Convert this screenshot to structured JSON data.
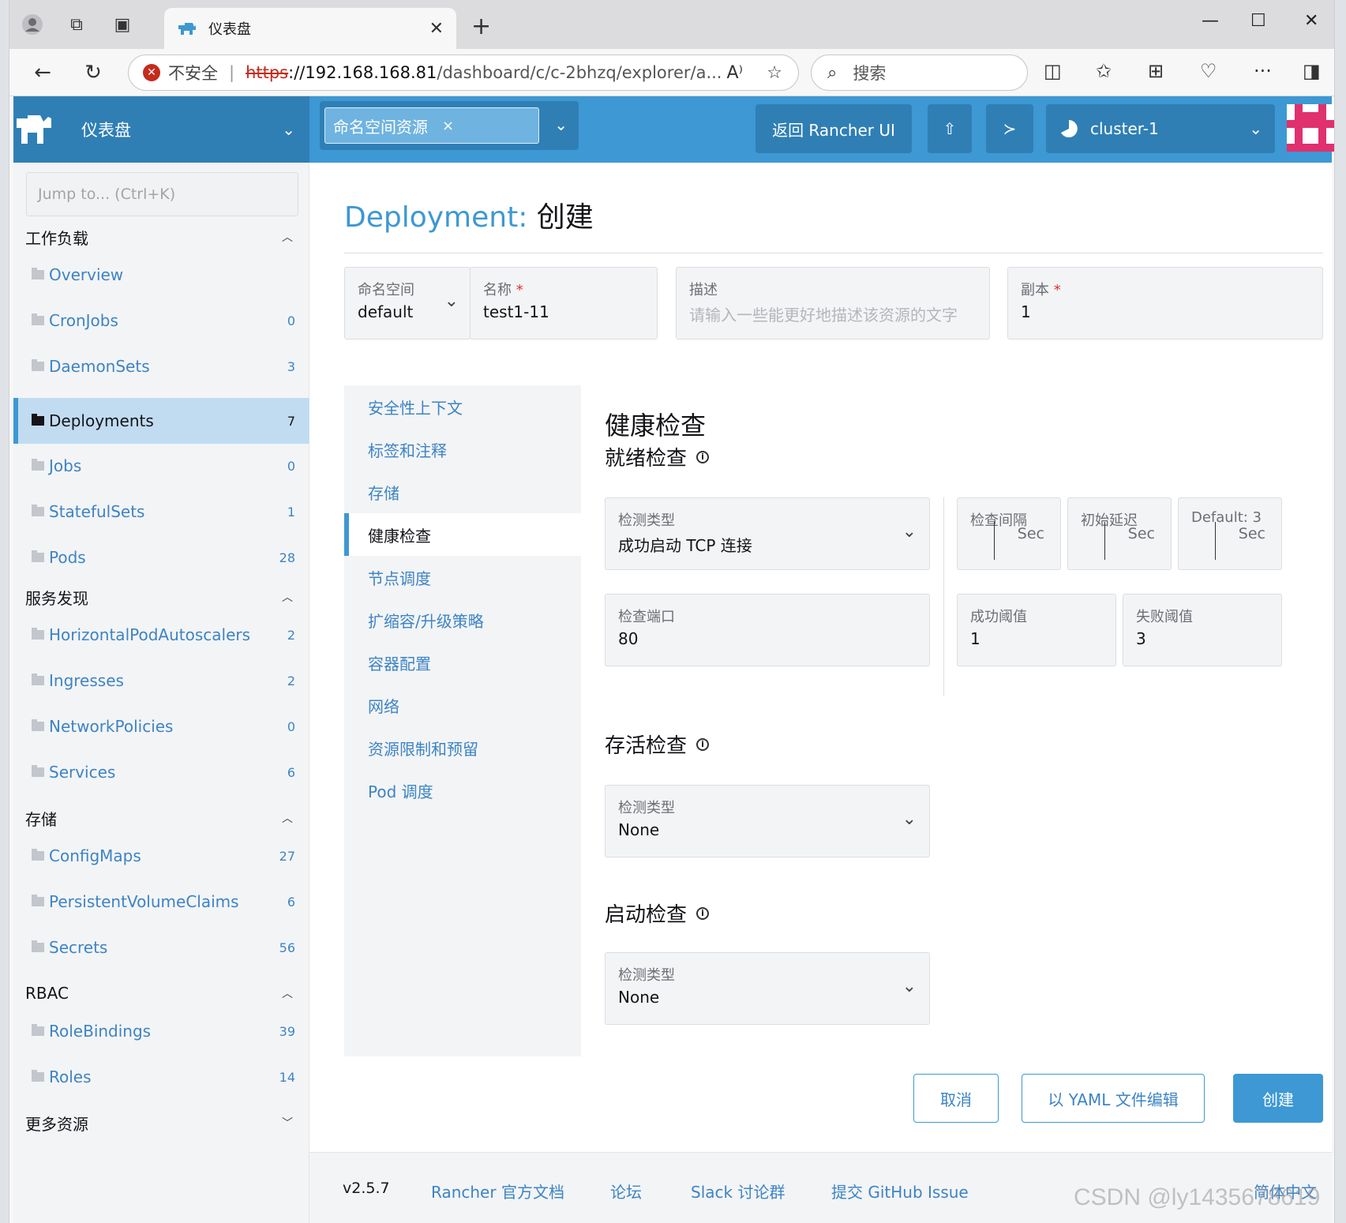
{
  "browser": {
    "tab_title": "仪表盘",
    "insecure_label": "不安全",
    "url_protocol": "https",
    "url_host": "://192.168.168.81",
    "url_path": "/dashboard/c/c-2bhzq/explorer/a...",
    "search_placeholder": "搜索"
  },
  "header": {
    "title": "仪表盘",
    "namespace_chip": "命名空间资源",
    "back_button": "返回 Rancher UI",
    "cluster": "cluster-1"
  },
  "sidebar": {
    "jump_placeholder": "Jump to... (Ctrl+K)",
    "groups": [
      {
        "label": "工作负载"
      },
      {
        "label": "服务发现"
      },
      {
        "label": "存储"
      },
      {
        "label": "RBAC"
      },
      {
        "label": "更多资源"
      }
    ],
    "items": [
      {
        "label": "Overview",
        "count": ""
      },
      {
        "label": "CronJobs",
        "count": "0"
      },
      {
        "label": "DaemonSets",
        "count": "3"
      },
      {
        "label": "Deployments",
        "count": "7"
      },
      {
        "label": "Jobs",
        "count": "0"
      },
      {
        "label": "StatefulSets",
        "count": "1"
      },
      {
        "label": "Pods",
        "count": "28"
      },
      {
        "label": "HorizontalPodAutoscalers",
        "count": "2"
      },
      {
        "label": "Ingresses",
        "count": "2"
      },
      {
        "label": "NetworkPolicies",
        "count": "0"
      },
      {
        "label": "Services",
        "count": "6"
      },
      {
        "label": "ConfigMaps",
        "count": "27"
      },
      {
        "label": "PersistentVolumeClaims",
        "count": "6"
      },
      {
        "label": "Secrets",
        "count": "56"
      },
      {
        "label": "RoleBindings",
        "count": "39"
      },
      {
        "label": "Roles",
        "count": "14"
      }
    ]
  },
  "page": {
    "title_kind": "Deployment:",
    "title_action": "创建",
    "namespace_label": "命名空间",
    "namespace_value": "default",
    "name_label": "名称",
    "name_value": "test1-11",
    "desc_label": "描述",
    "desc_placeholder": "请输入一些能更好地描述该资源的文字",
    "replicas_label": "副本",
    "replicas_value": "1",
    "required_mark": "*"
  },
  "tabs": [
    "安全性上下文",
    "标签和注释",
    "存储",
    "健康检查",
    "节点调度",
    "扩缩容/升级策略",
    "容器配置",
    "网络",
    "资源限制和预留",
    "Pod 调度"
  ],
  "health": {
    "title": "健康检查",
    "readiness_title": "就绪检查",
    "liveness_title": "存活检查",
    "startup_title": "启动检查",
    "probe_type_label": "检测类型",
    "readiness_type": "成功启动 TCP 连接",
    "interval_label": "检查间隔",
    "delay_label": "初始延迟",
    "timeout_label": "Default: 3",
    "unit": "Sec",
    "port_label": "检查端口",
    "port_value": "80",
    "success_label": "成功阈值",
    "success_value": "1",
    "failure_label": "失败阈值",
    "failure_value": "3",
    "liveness_type": "None",
    "startup_type": "None"
  },
  "actions": {
    "cancel": "取消",
    "yaml": "以 YAML 文件编辑",
    "create": "创建"
  },
  "footer": {
    "version": "v2.5.7",
    "docs": "Rancher 官方文档",
    "forum": "论坛",
    "slack": "Slack 讨论群",
    "issue": "提交 GitHub Issue",
    "language": "简体中文"
  },
  "watermark": "CSDN @ly1435678619",
  "colors": {
    "brand": "#3d98d3",
    "brand_dark": "#2f7fb5",
    "link": "#3d84c4",
    "active_bg": "#c1dcf1"
  }
}
